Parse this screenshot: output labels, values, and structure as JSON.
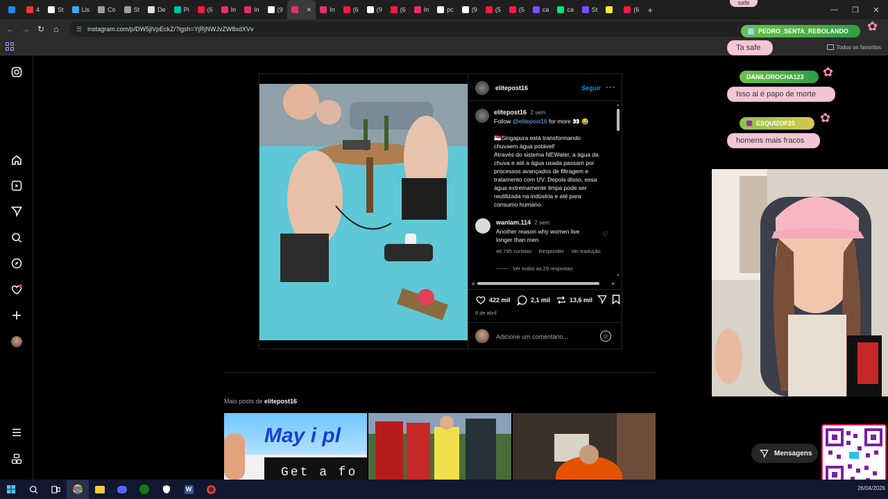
{
  "browser": {
    "tabs": [
      {
        "label": "",
        "color": "#1e88e5"
      },
      {
        "label": "4",
        "color": "#e53935"
      },
      {
        "label": "St",
        "color": "#fafafa"
      },
      {
        "label": "Lis",
        "color": "#42a5f5"
      },
      {
        "label": "Co",
        "color": "#9e9e9e"
      },
      {
        "label": "St",
        "color": "#9e9e9e"
      },
      {
        "label": "De",
        "color": "#e0e0e0"
      },
      {
        "label": "Pi",
        "color": "#00bfa5"
      },
      {
        "label": "(6",
        "color": "#ff1744"
      },
      {
        "label": "In",
        "color": "#e1306c"
      },
      {
        "label": "In",
        "color": "#e1306c"
      },
      {
        "label": "(9",
        "color": "#fafafa"
      },
      {
        "label": "",
        "color": "#e1306c"
      },
      {
        "label": "In",
        "color": "#e1306c"
      },
      {
        "label": "(6",
        "color": "#ff1744"
      },
      {
        "label": "(9",
        "color": "#fafafa"
      },
      {
        "label": "(6",
        "color": "#ff1744"
      },
      {
        "label": "In",
        "color": "#e1306c"
      },
      {
        "label": "pc",
        "color": "#fafafa"
      },
      {
        "label": "(9",
        "color": "#fafafa"
      },
      {
        "label": "(5",
        "color": "#ff1744"
      },
      {
        "label": "(5",
        "color": "#ff1744"
      },
      {
        "label": "ca",
        "color": "#7c4dff"
      },
      {
        "label": "ca",
        "color": "#00e676"
      },
      {
        "label": "St",
        "color": "#7c4dff"
      },
      {
        "label": "",
        "color": "#ffeb3b"
      },
      {
        "label": "(6",
        "color": "#ff1744"
      }
    ],
    "url": "instagram.com/p/DW5jlVpEckZ/?igsh=YjRjNWJvZW8xdXVv",
    "bookmarks_label": "Todos os favoritos"
  },
  "post": {
    "header_username": "elitepost16",
    "follow_label": "Seguir",
    "caption": {
      "username": "elitepost16",
      "time": "2 sem",
      "line1_prefix": "Follow ",
      "mention": "@elitepost16",
      "line1_suffix": " for more 👀 😂",
      "text_lines": [
        "🇸🇬Singapura está transformando",
        "chuvaem água potável!",
        "Através do sistema NEWater, a água da",
        "chuva e até a água usada passam por",
        "processos avançados de filtragem e",
        "tratamento com UV. Depois disso, essa",
        "água extremamente limpa pode ser",
        "reutilizada na indústria e até para",
        "consumo humano."
      ]
    },
    "comment": {
      "username": "wanlam.114",
      "time": "2 sem",
      "line1": "Another reason why women live",
      "line2": "longer than men",
      "likes": "46.785 curtidas",
      "reply": "Responder",
      "translate": "Ver tradução",
      "view_replies": "Ver todas as 29 respostas"
    },
    "likes": "422 mil",
    "comments": "2,1 mil",
    "reposts": "13,6 mil",
    "date": "9 de abril",
    "comment_placeholder": "Adicione um comentário..."
  },
  "more_posts": {
    "prefix": "Mais posts de ",
    "username": "elitepost16",
    "thumb1_text_top": "May i pl",
    "thumb1_text_bottom": "Get a fo"
  },
  "messages_label": "Mensagens",
  "overlay": {
    "top_partial": "safe",
    "chat": [
      {
        "name": "PEDRO_SENTA_REBOLANDO",
        "message": "Ta safe"
      },
      {
        "name": "DANILOROCHA123",
        "message": "Isso ai é papo de morte"
      },
      {
        "name": "ESQUIZOF25",
        "message": "homens mais fracos"
      }
    ]
  },
  "taskbar": {
    "date": "26/04/2026"
  }
}
